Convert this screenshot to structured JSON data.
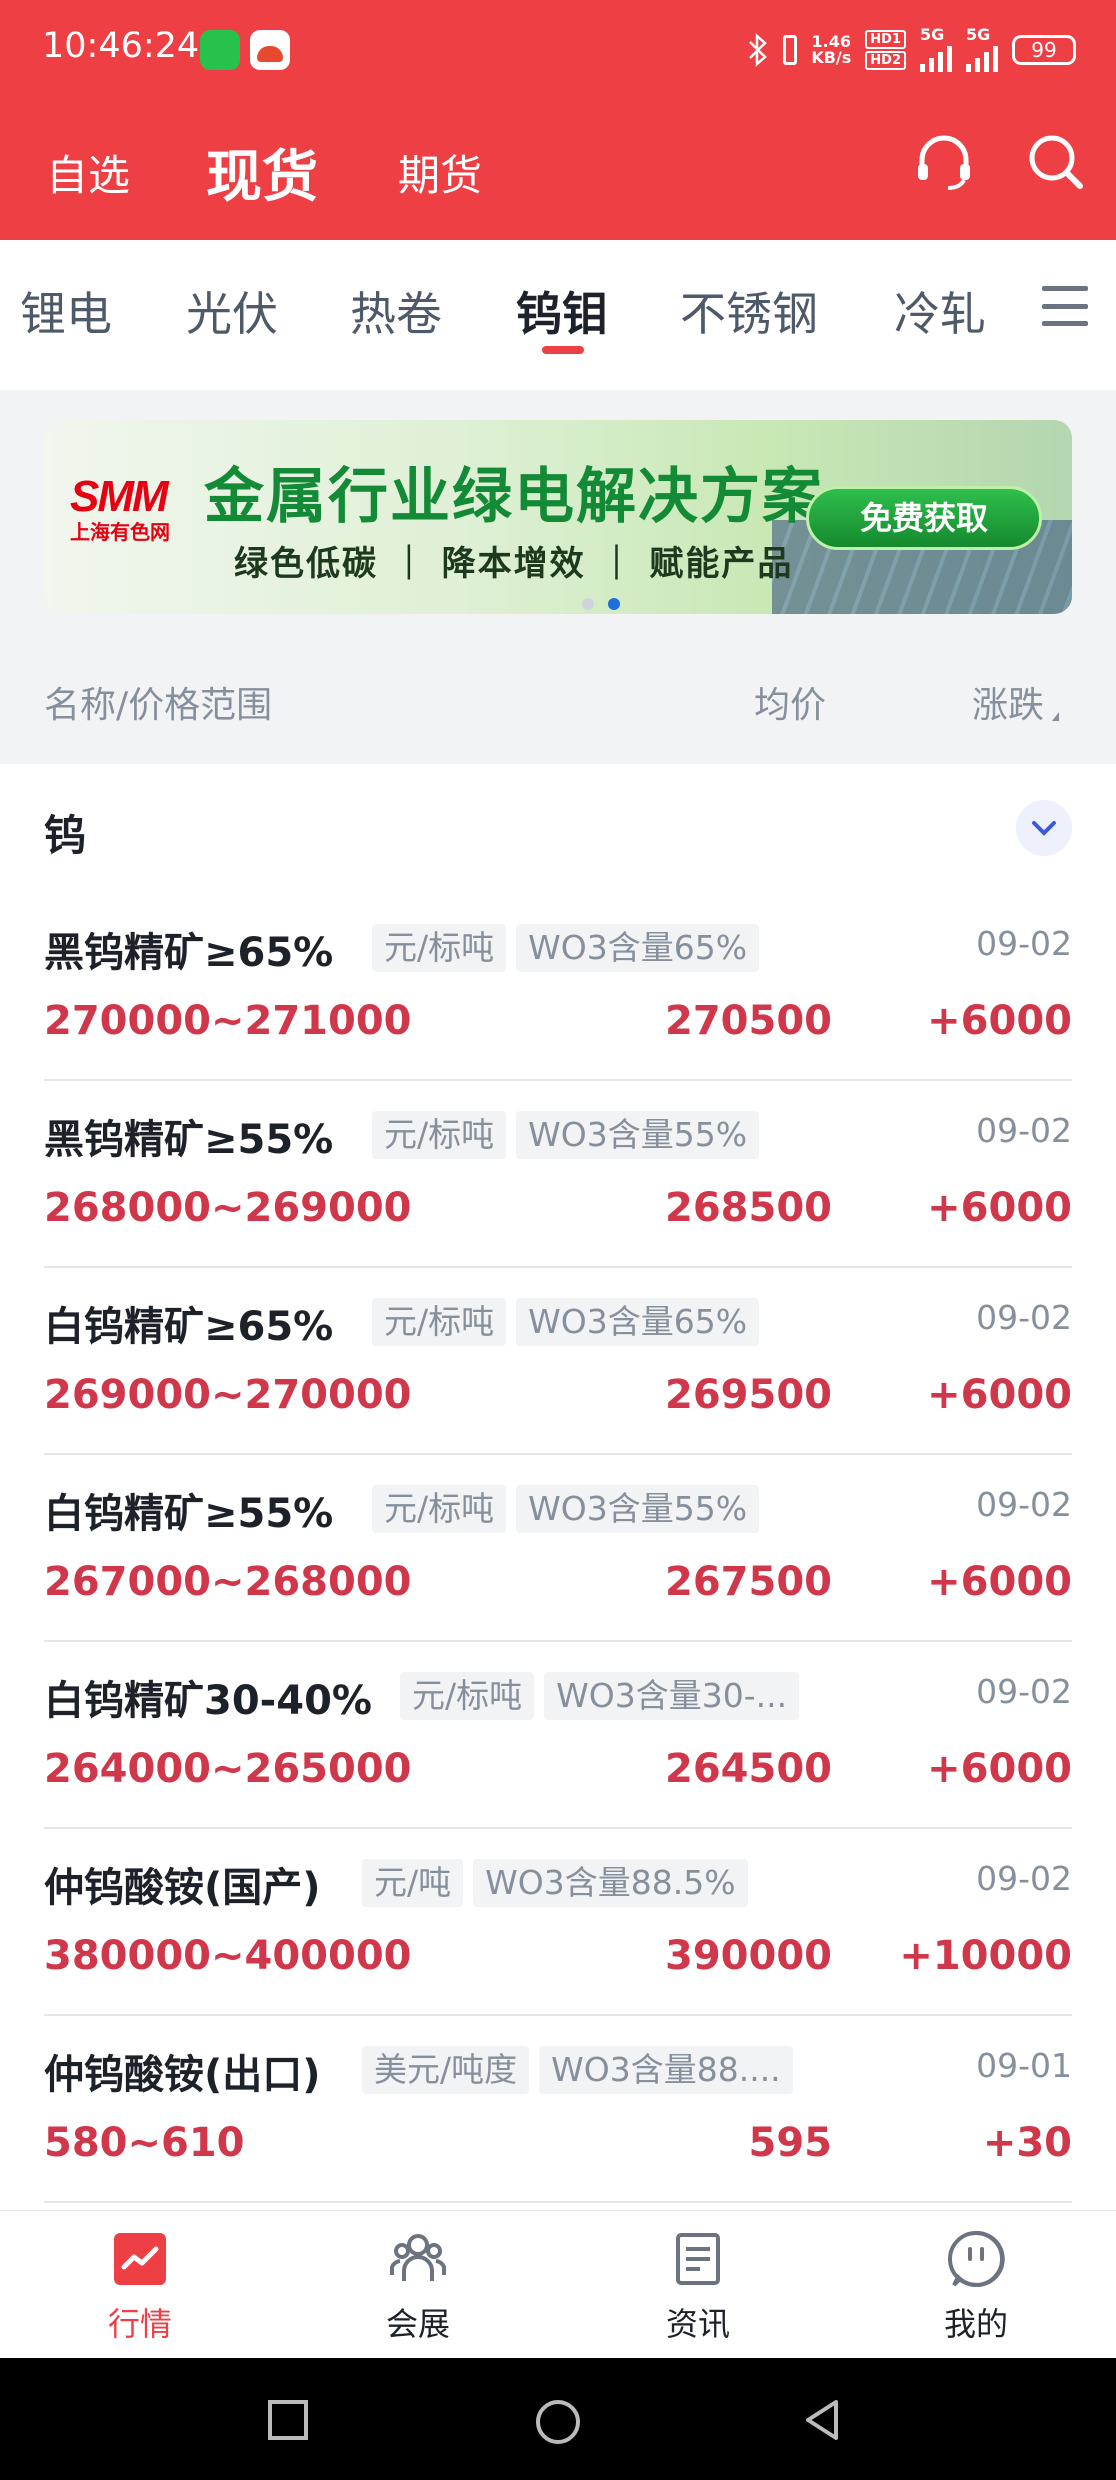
{
  "status_bar": {
    "time": "10:46:24",
    "net_speed_value": "1.46",
    "net_speed_unit": "KB/s",
    "hd1": "HD1",
    "hd2": "HD2",
    "sig1": "5G",
    "sig2": "5G",
    "battery": "99"
  },
  "header": {
    "tabs": [
      {
        "label": "自选"
      },
      {
        "label": "现货"
      },
      {
        "label": "期货"
      }
    ],
    "active_tab": "现货",
    "icons": [
      "headset-icon",
      "search-icon"
    ]
  },
  "categories": {
    "items": [
      {
        "label": "锂电"
      },
      {
        "label": "光伏"
      },
      {
        "label": "热卷"
      },
      {
        "label": "钨钼"
      },
      {
        "label": "不锈钢"
      },
      {
        "label": "冷轧"
      }
    ],
    "active": "钨钼",
    "accent": "#ee3f45"
  },
  "banner": {
    "logo": "SMM",
    "logo_sub": "上海有色网",
    "title": "金属行业绿电解决方案",
    "subtitle": "绿色低碳 ｜ 降本增效 ｜ 赋能产品",
    "cta": "免费获取"
  },
  "columns": {
    "name": "名称/价格范围",
    "avg": "均价",
    "change": "涨跌"
  },
  "group": {
    "title": "钨"
  },
  "rows": [
    {
      "name": "黑钨精矿≥65%",
      "unit": "元/标吨",
      "spec": "WO3含量65%",
      "date": "09-02",
      "range": "270000~271000",
      "avg": "270500",
      "change": "+6000"
    },
    {
      "name": "黑钨精矿≥55%",
      "unit": "元/标吨",
      "spec": "WO3含量55%",
      "date": "09-02",
      "range": "268000~269000",
      "avg": "268500",
      "change": "+6000"
    },
    {
      "name": "白钨精矿≥65%",
      "unit": "元/标吨",
      "spec": "WO3含量65%",
      "date": "09-02",
      "range": "269000~270000",
      "avg": "269500",
      "change": "+6000"
    },
    {
      "name": "白钨精矿≥55%",
      "unit": "元/标吨",
      "spec": "WO3含量55%",
      "date": "09-02",
      "range": "267000~268000",
      "avg": "267500",
      "change": "+6000"
    },
    {
      "name": "白钨精矿30-40%",
      "unit": "元/标吨",
      "spec": "WO3含量30-...",
      "date": "09-02",
      "range": "264000~265000",
      "avg": "264500",
      "change": "+6000"
    },
    {
      "name": "仲钨酸铵(国产)",
      "unit": "元/吨",
      "spec": "WO3含量88.5%",
      "date": "09-02",
      "range": "380000~400000",
      "avg": "390000",
      "change": "+10000"
    },
    {
      "name": "仲钨酸铵(出口)",
      "unit": "美元/吨度",
      "spec": "WO3含量88....",
      "date": "09-01",
      "range": "580~610",
      "avg": "595",
      "change": "+30"
    }
  ],
  "bottom_nav": [
    {
      "label": "行情",
      "icon": "market-icon",
      "active": true
    },
    {
      "label": "会展",
      "icon": "people-icon",
      "active": false
    },
    {
      "label": "资讯",
      "icon": "news-icon",
      "active": false
    },
    {
      "label": "我的",
      "icon": "profile-icon",
      "active": false
    }
  ],
  "colors": {
    "brand_red": "#ee3f45",
    "price_red": "#d0374a",
    "muted": "#86909c"
  }
}
